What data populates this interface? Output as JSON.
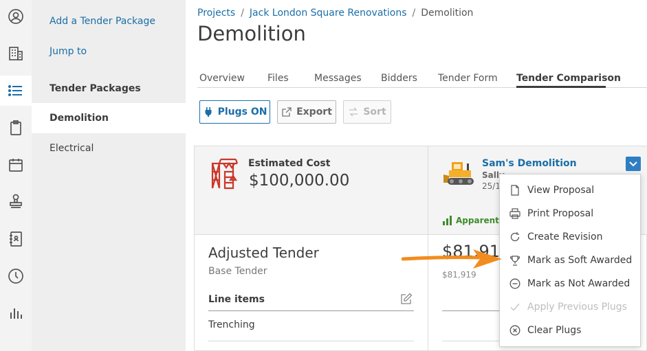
{
  "sidebar": {
    "rail_icons": [
      "user-circle-icon",
      "building-icon",
      "list-icon",
      "clipboard-icon",
      "calendar-icon",
      "stamp-icon",
      "address-book-icon",
      "clock-icon",
      "bar-chart-icon"
    ],
    "add_link": "Add a Tender Package",
    "jump_link": "Jump to",
    "section_heading": "Tender Packages",
    "packages": [
      "Demolition",
      "Electrical"
    ]
  },
  "breadcrumb": {
    "items": [
      "Projects",
      "Jack London Square Renovations",
      "Demolition"
    ],
    "separator": "/"
  },
  "page_title": "Demolition",
  "tabs": [
    "Overview",
    "Files",
    "Messages",
    "Bidders",
    "Tender Form",
    "Tender Comparison"
  ],
  "toolbar": {
    "plugs": "Plugs ON",
    "export": "Export",
    "sort": "Sort"
  },
  "estimate": {
    "label": "Estimated Cost",
    "value": "$100,000.00"
  },
  "bidder": {
    "name": "Sam's Demolition",
    "contact": "Sally",
    "date": "25/1",
    "apparent": "Apparent lo",
    "amount": "$81,919",
    "amount_small": "$81,919"
  },
  "adjusted": {
    "title": "Adjusted Tender",
    "subtitle": "Base Tender",
    "line_items_label": "Line items",
    "rows": [
      "Trenching"
    ]
  },
  "menu": {
    "items": [
      {
        "label": "View Proposal",
        "icon": "document-icon",
        "disabled": false
      },
      {
        "label": "Print Proposal",
        "icon": "printer-icon",
        "disabled": false
      },
      {
        "label": "Create Revision",
        "icon": "refresh-icon",
        "disabled": false
      },
      {
        "label": "Mark as Soft Awarded",
        "icon": "trophy-icon",
        "disabled": false
      },
      {
        "label": "Mark as Not Awarded",
        "icon": "minus-circle-icon",
        "disabled": false
      },
      {
        "label": "Apply Previous Plugs",
        "icon": "check-icon",
        "disabled": true
      },
      {
        "label": "Clear Plugs",
        "icon": "x-circle-icon",
        "disabled": false
      }
    ]
  },
  "colors": {
    "link": "#1a6ea8",
    "accent": "#2f7ec3",
    "arrow": "#f28c1e",
    "success": "#3f8c2c"
  }
}
